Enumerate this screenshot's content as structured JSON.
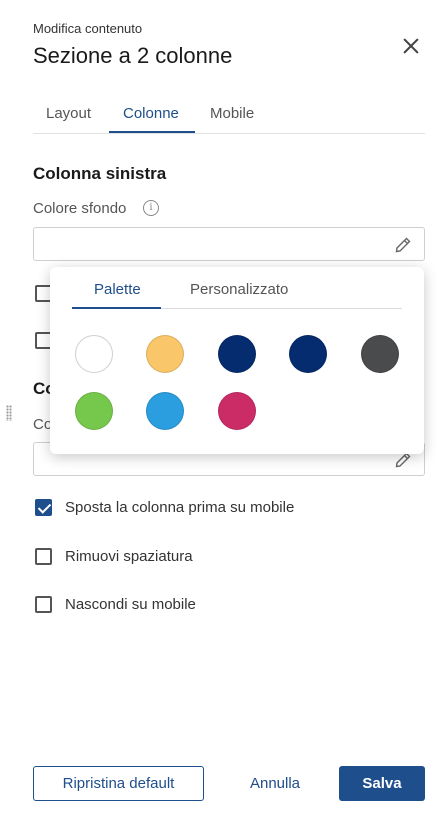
{
  "header": {
    "subtitle": "Modifica contenuto",
    "title": "Sezione a 2 colonne"
  },
  "tabs": [
    {
      "label": "Layout",
      "active": false
    },
    {
      "label": "Colonne",
      "active": true
    },
    {
      "label": "Mobile",
      "active": false
    }
  ],
  "left_column": {
    "heading": "Colonna sinistra",
    "bg_color_label": "Colore sfondo",
    "bg_color_value": ""
  },
  "right_column": {
    "heading_partial": "Co",
    "bg_color_label_partial": "Co",
    "bg_color_value": ""
  },
  "color_popover": {
    "tabs": [
      {
        "label": "Palette",
        "active": true
      },
      {
        "label": "Personalizzato",
        "active": false
      }
    ],
    "swatches": [
      "#ffffff",
      "#f9c66a",
      "#042c6e",
      "#042c6e",
      "#4a4b4d",
      "#76c84c",
      "#2a9ede",
      "#cc2c66"
    ]
  },
  "options": [
    {
      "label": "Sposta la colonna prima su mobile",
      "checked": true
    },
    {
      "label": "Rimuovi spaziatura",
      "checked": false
    },
    {
      "label": "Nascondi su mobile",
      "checked": false
    }
  ],
  "footer": {
    "reset_label": "Ripristina default",
    "cancel_label": "Annulla",
    "save_label": "Salva"
  },
  "colors": {
    "accent": "#1f4e8c"
  }
}
